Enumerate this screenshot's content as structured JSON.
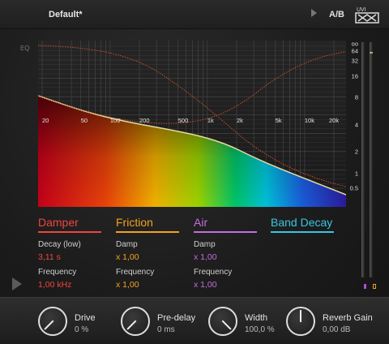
{
  "header": {
    "preset_name": "Default*",
    "ab_label": "A/B",
    "logo_text": "UVI"
  },
  "eq": {
    "label": "EQ",
    "freq_ticks": [
      "20",
      "50",
      "100",
      "200",
      "500",
      "1k",
      "2k",
      "5k",
      "10k",
      "20k"
    ],
    "decay_ticks": [
      "oo",
      "64",
      "32",
      "16",
      "8",
      "4",
      "2",
      "1",
      "0.5"
    ]
  },
  "bands": [
    {
      "title": "Damper",
      "color": "#f0453d",
      "params": [
        {
          "label": "Decay (low)",
          "value": "3,11 s"
        },
        {
          "label": "Frequency",
          "value": "1,00 kHz"
        }
      ]
    },
    {
      "title": "Friction",
      "color": "#f3a21f",
      "params": [
        {
          "label": "Damp",
          "value": "x 1,00"
        },
        {
          "label": "Frequency",
          "value": "x 1,00"
        }
      ]
    },
    {
      "title": "Air",
      "color": "#c26ee0",
      "params": [
        {
          "label": "Damp",
          "value": "x 1,00"
        },
        {
          "label": "Frequency",
          "value": "x 1,00"
        }
      ]
    },
    {
      "title": "Band Decay",
      "color": "#39c6e0",
      "params": []
    }
  ],
  "knobs": [
    {
      "label": "Drive",
      "value": "0 %"
    },
    {
      "label": "Pre-delay",
      "value": "0 ms"
    },
    {
      "label": "Width",
      "value": "100,0 %"
    },
    {
      "label": "Reverb Gain",
      "value": "0,00 dB"
    }
  ],
  "colors": {
    "curve": "#c9a85a",
    "dotted": "#c8502a",
    "meter_left_marker": "#b34bd6",
    "meter_right_marker": "#e8a21d"
  }
}
